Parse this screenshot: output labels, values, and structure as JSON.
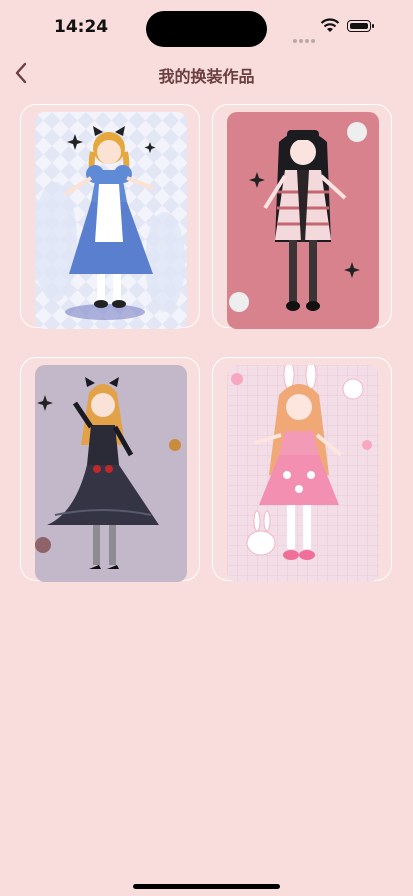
{
  "status_bar": {
    "time": "14:24"
  },
  "nav": {
    "title": "我的换装作品"
  },
  "works": [
    {
      "id": "work-1",
      "theme": "blue-dress-girl",
      "bg": "#eef0fa"
    },
    {
      "id": "work-2",
      "theme": "pink-gothic-girl",
      "bg": "#d8828e"
    },
    {
      "id": "work-3",
      "theme": "black-gown-girl",
      "bg": "#c3b8c9"
    },
    {
      "id": "work-4",
      "theme": "bunny-pink-girl",
      "bg": "#f3dde7"
    }
  ],
  "colors": {
    "background": "#f9dcdc",
    "title": "#6b3f3f"
  }
}
